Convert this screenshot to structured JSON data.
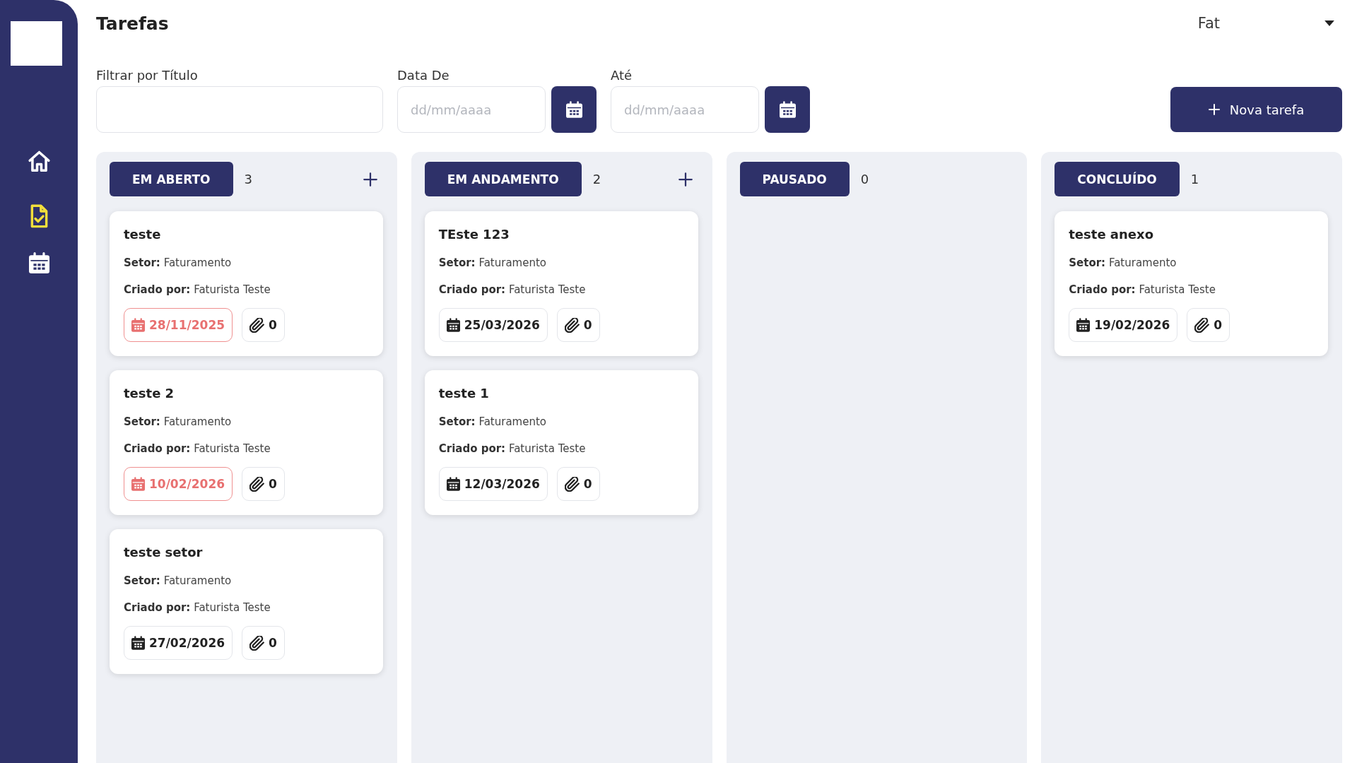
{
  "sidebar": {
    "items": [
      {
        "kind": "home",
        "selected": false
      },
      {
        "kind": "tasks",
        "selected": true
      },
      {
        "kind": "calendar",
        "selected": false
      }
    ]
  },
  "header": {
    "title": "Tarefas",
    "user_menu": {
      "label": "Fat"
    }
  },
  "filters": [
    {
      "kind": "text",
      "label": "Filtrar por Título"
    },
    {
      "kind": "date",
      "label": "Data De",
      "placeholder": "dd/mm/aaaa"
    },
    {
      "kind": "date",
      "label": "Até",
      "placeholder": "dd/mm/aaaa"
    }
  ],
  "new_task_button": {
    "label": "Nova tarefa"
  },
  "columns": [
    {
      "title": "EM ABERTO",
      "count": "3",
      "can_add": true,
      "cards": [
        {
          "title": "teste",
          "sector": "**Setor:** Faturamento",
          "created_by": "**Criado por:** Faturista Teste",
          "due_date": "28/11/2025",
          "overdue": true,
          "attachments": "0"
        },
        {
          "title": "teste 2",
          "sector": "**Setor:** Faturamento",
          "created_by": "**Criado por:** Faturista Teste",
          "due_date": "10/02/2026",
          "overdue": true,
          "attachments": "0"
        },
        {
          "title": "teste setor",
          "sector": "**Setor:** Faturamento",
          "created_by": "**Criado por:** Faturista Teste",
          "due_date": "27/02/2026",
          "overdue": false,
          "attachments": "0"
        }
      ]
    },
    {
      "title": "EM ANDAMENTO",
      "count": "2",
      "can_add": true,
      "cards": [
        {
          "title": "TEste 123",
          "sector": "**Setor:** Faturamento",
          "created_by": "**Criado por:** Faturista Teste",
          "due_date": "25/03/2026",
          "overdue": false,
          "attachments": "0"
        },
        {
          "title": "teste 1",
          "sector": "**Setor:** Faturamento",
          "created_by": "**Criado por:** Faturista Teste",
          "due_date": "12/03/2026",
          "overdue": false,
          "attachments": "0"
        }
      ]
    },
    {
      "title": "PAUSADO",
      "count": "0",
      "can_add": false
    },
    {
      "title": "CONCLUÍDO",
      "count": "1",
      "can_add": false,
      "cards": [
        {
          "title": "teste anexo",
          "sector": "**Setor:** Faturamento",
          "created_by": "**Criado por:** Faturista Teste",
          "due_date": "19/02/2026",
          "overdue": false,
          "attachments": "0"
        }
      ]
    }
  ]
}
